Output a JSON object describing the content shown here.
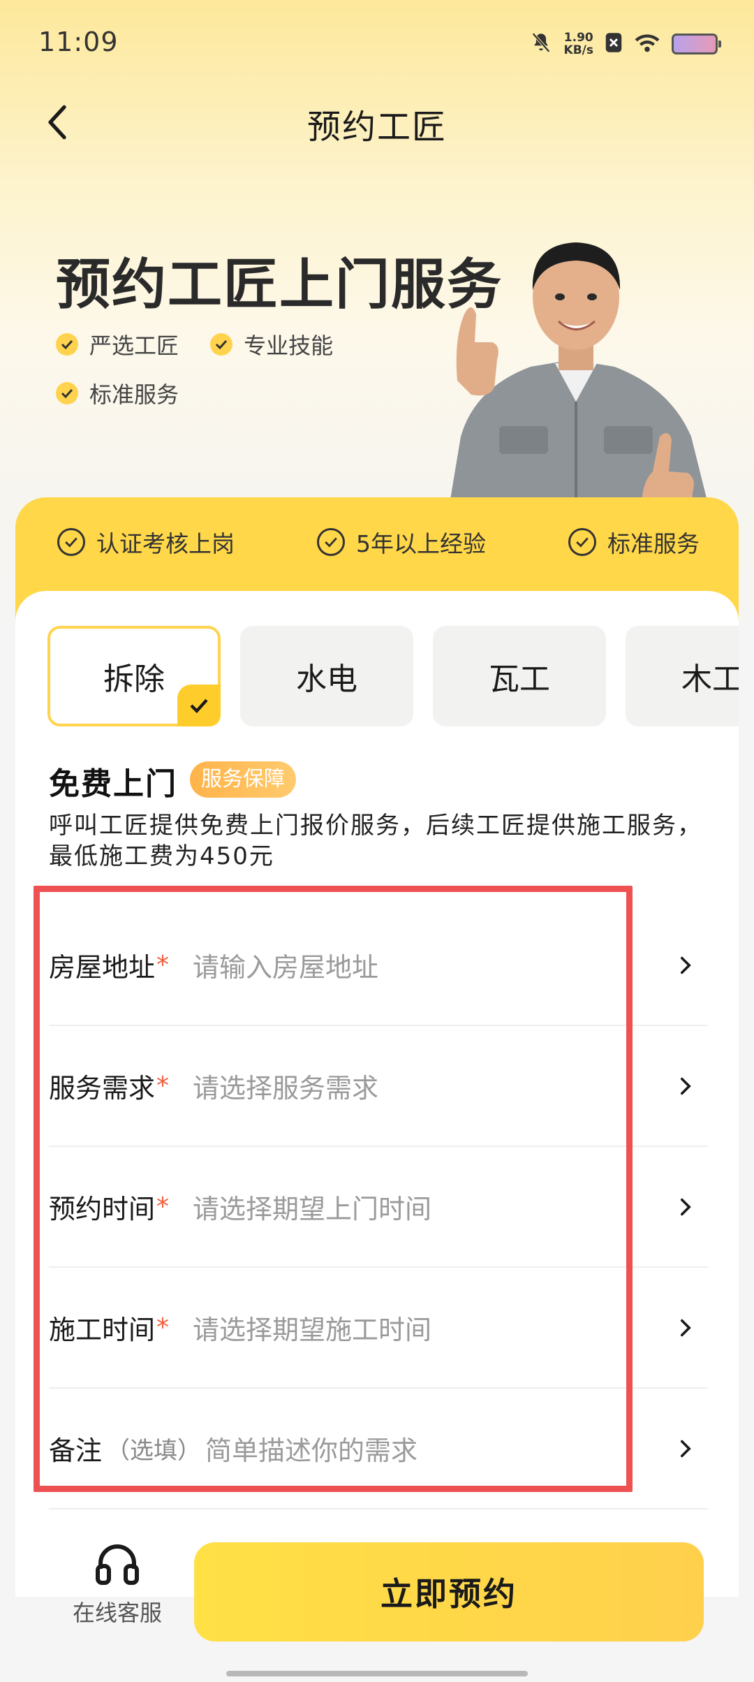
{
  "status_bar": {
    "time": "11:09",
    "speed_value": "1.90",
    "speed_unit": "KB/s"
  },
  "nav": {
    "title": "预约工匠"
  },
  "hero": {
    "title": "预约工匠上门服务",
    "features": [
      "严选工匠",
      "专业技能",
      "标准服务"
    ]
  },
  "badges": [
    "认证考核上岗",
    "5年以上经验",
    "标准服务"
  ],
  "categories": [
    {
      "label": "拆除",
      "selected": true
    },
    {
      "label": "水电",
      "selected": false
    },
    {
      "label": "瓦工",
      "selected": false
    },
    {
      "label": "木工",
      "selected": false
    }
  ],
  "free_visit": {
    "title": "免费上门",
    "tag": "服务保障",
    "description": "呼叫工匠提供免费上门报价服务，后续工匠提供施工服务，最低施工费为450元"
  },
  "form": {
    "rows": [
      {
        "label": "房屋地址",
        "required": "*",
        "placeholder": "请输入房屋地址"
      },
      {
        "label": "服务需求",
        "required": "*",
        "placeholder": "请选择服务需求"
      },
      {
        "label": "预约时间",
        "required": "*",
        "placeholder": "请选择期望上门时间"
      },
      {
        "label": "施工时间",
        "required": "*",
        "placeholder": "请选择期望施工时间"
      },
      {
        "label": "备注",
        "optional": "（选填）",
        "placeholder": "简单描述你的需求"
      }
    ]
  },
  "bottom": {
    "service_label": "在线客服",
    "book_label": "立即预约"
  },
  "colors": {
    "accent": "#ffd748",
    "required": "#f05d3b",
    "highlight": "#ee5151"
  }
}
